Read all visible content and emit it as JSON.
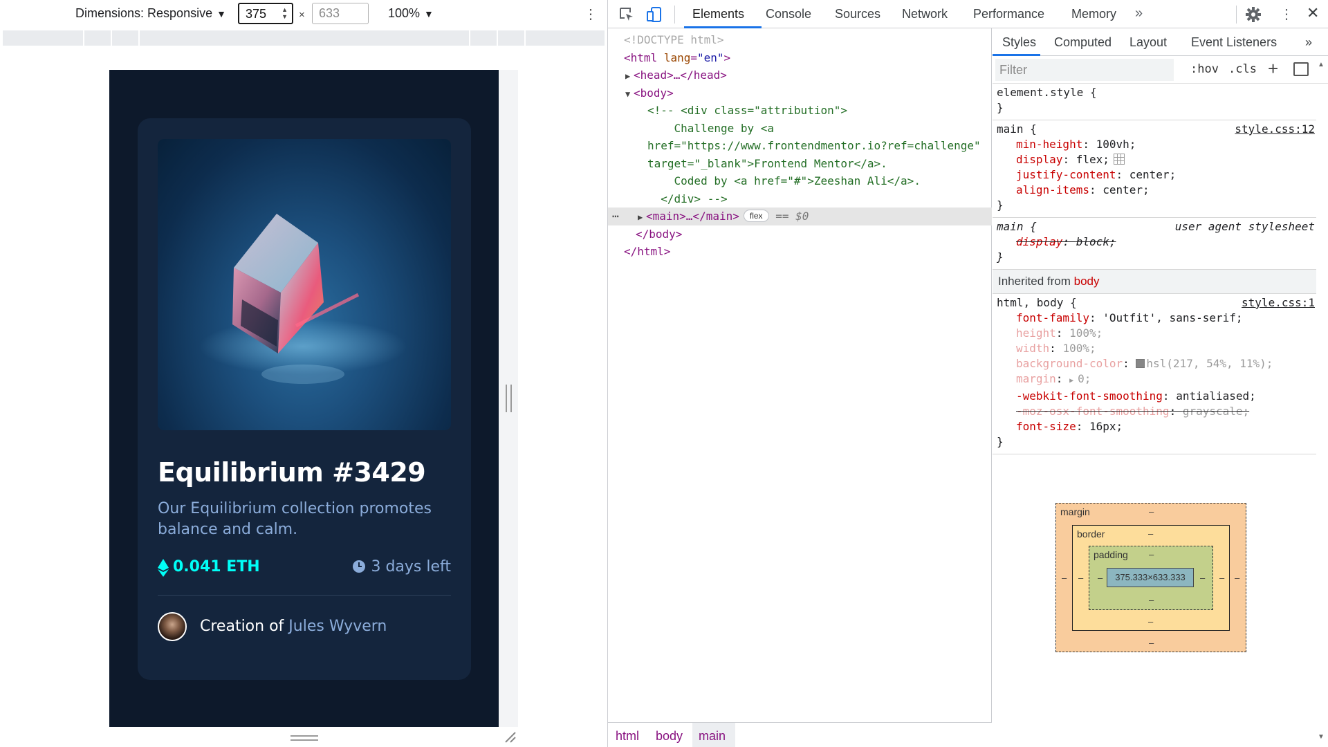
{
  "device_toolbar": {
    "dimensions_label": "Dimensions: Responsive",
    "width_value": "375",
    "times": "×",
    "height_placeholder": "633",
    "zoom": "100%"
  },
  "card": {
    "title": "Equilibrium #3429",
    "description": "Our Equilibrium collection promotes balance and calm.",
    "price": "0.041 ETH",
    "time_left": "3 days left",
    "creation_prefix": "Creation of",
    "creator_name": "Jules Wyvern"
  },
  "devtools": {
    "tabs": [
      "Elements",
      "Console",
      "Sources",
      "Network",
      "Performance",
      "Memory"
    ],
    "more_tabs": "»",
    "dom": {
      "doctype": "<!DOCTYPE html>",
      "html_open_tag": "<html",
      "html_attr": "lang",
      "html_attr_value": "\"en\"",
      "head": "<head>…</head>",
      "body_open": "<body>",
      "comment_lines": [
        "<!-- <div class=\"attribution\">",
        "    Challenge by <a",
        "href=\"https://www.frontendmentor.io?ref=challenge\"",
        "target=\"_blank\">Frontend Mentor</a>.",
        "    Coded by <a href=\"#\">Zeeshan Ali</a>.",
        "  </div> -->"
      ],
      "main_collapsed": "<main>…</main>",
      "flex_badge": "flex",
      "dollar0": "== $0",
      "body_close": "</body>",
      "html_close": "</html>"
    },
    "breadcrumbs": [
      "html",
      "body",
      "main"
    ],
    "styles_tabs": [
      "Styles",
      "Computed",
      "Layout",
      "Event Listeners"
    ],
    "filter_placeholder": "Filter",
    "hov": ":hov",
    "cls": ".cls",
    "rules": {
      "element_style": "element.style {",
      "main_selector": "main {",
      "main_source": "style.css:12",
      "main_decls": [
        {
          "prop": "min-height",
          "value": "100vh;"
        },
        {
          "prop": "display",
          "value": "flex;"
        },
        {
          "prop": "justify-content",
          "value": "center;"
        },
        {
          "prop": "align-items",
          "value": "center;"
        }
      ],
      "ua_selector": "main {",
      "ua_source": "user agent stylesheet",
      "ua_decl": {
        "prop": "display",
        "value": "block;"
      },
      "inherited_label": "Inherited from",
      "inherited_from": "body",
      "body_selector": "html, body {",
      "body_source": "style.css:1",
      "body_decls": [
        {
          "prop": "font-family",
          "value": "'Outfit', sans-serif;"
        },
        {
          "prop": "height",
          "value": "100%;"
        },
        {
          "prop": "width",
          "value": "100%;"
        },
        {
          "prop": "background-color",
          "value": "hsl(217, 54%, 11%);"
        },
        {
          "prop": "margin",
          "value": "0;"
        },
        {
          "prop": "-webkit-font-smoothing",
          "value": "antialiased;"
        },
        {
          "prop": "-moz-osx-font-smoothing",
          "value": "grayscale;"
        },
        {
          "prop": "font-size",
          "value": "16px;"
        }
      ],
      "close_brace": "}"
    },
    "box_model": {
      "margin_label": "margin",
      "border_label": "border",
      "padding_label": "padding",
      "content": "375.333×633.333",
      "dash": "–"
    }
  },
  "colors": {
    "page_bg": "hsl(217,54%,11%)",
    "card_bg": "hsl(216,50%,16%)",
    "cyan": "hsl(178,100%,50%)",
    "soft_blue": "hsl(215,51%,70%)",
    "devtools_accent": "#1a73e8"
  }
}
